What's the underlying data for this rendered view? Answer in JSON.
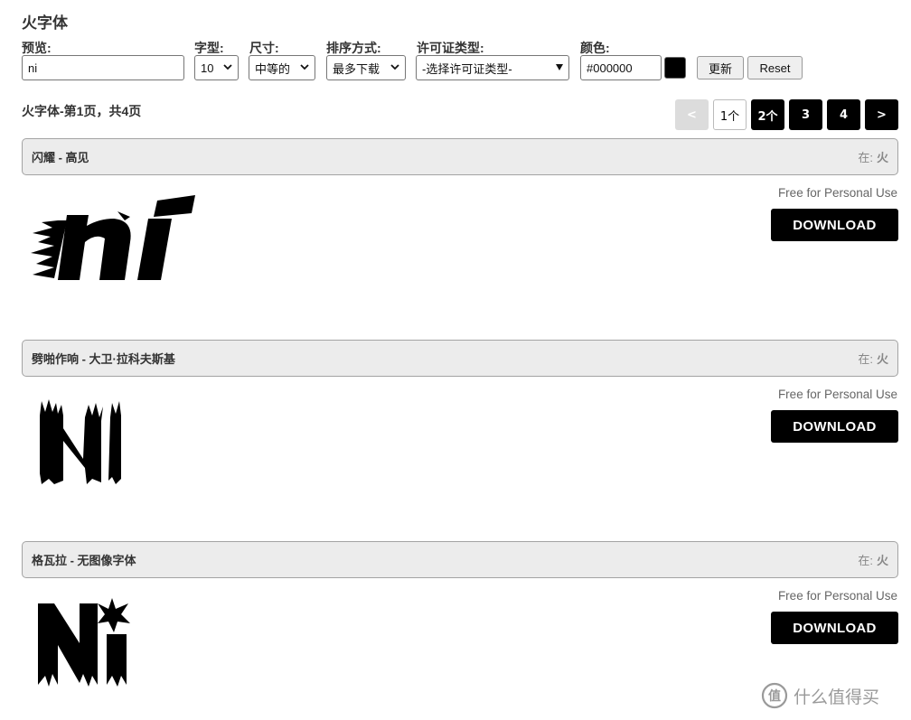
{
  "page": {
    "title": "火字体"
  },
  "filters": {
    "preview_label": "预览:",
    "preview_value": "ni",
    "glyph_label": "字型:",
    "glyph_value": "10",
    "size_label": "尺寸:",
    "size_value": "中等的",
    "sort_label": "排序方式:",
    "sort_value": "最多下载",
    "license_label": "许可证类型:",
    "license_value": "-选择许可证类型-",
    "color_label": "颜色:",
    "color_value": "#000000",
    "swatch_color": "#000000",
    "update_label": "更新",
    "reset_label": "Reset"
  },
  "pagination": {
    "info": "火字体-第1页，共4页",
    "prev": "<",
    "pages": [
      "1个",
      "2个",
      "3",
      "4"
    ],
    "next": ">"
  },
  "fonts": [
    {
      "name": "闪耀 - 高见",
      "category_prefix": "在:",
      "category": "火",
      "license": "Free for Personal Use",
      "download": "DOWNLOAD"
    },
    {
      "name": "劈啪作响 - 大卫·拉科夫斯基",
      "category_prefix": "在:",
      "category": "火",
      "license": "Free for Personal Use",
      "download": "DOWNLOAD"
    },
    {
      "name": "格瓦拉 - 无图像字体",
      "category_prefix": "在:",
      "category": "火",
      "license": "Free for Personal Use",
      "download": "DOWNLOAD"
    }
  ],
  "watermark": {
    "text": "什么值得买",
    "icon": "smzdm-logo-icon"
  }
}
